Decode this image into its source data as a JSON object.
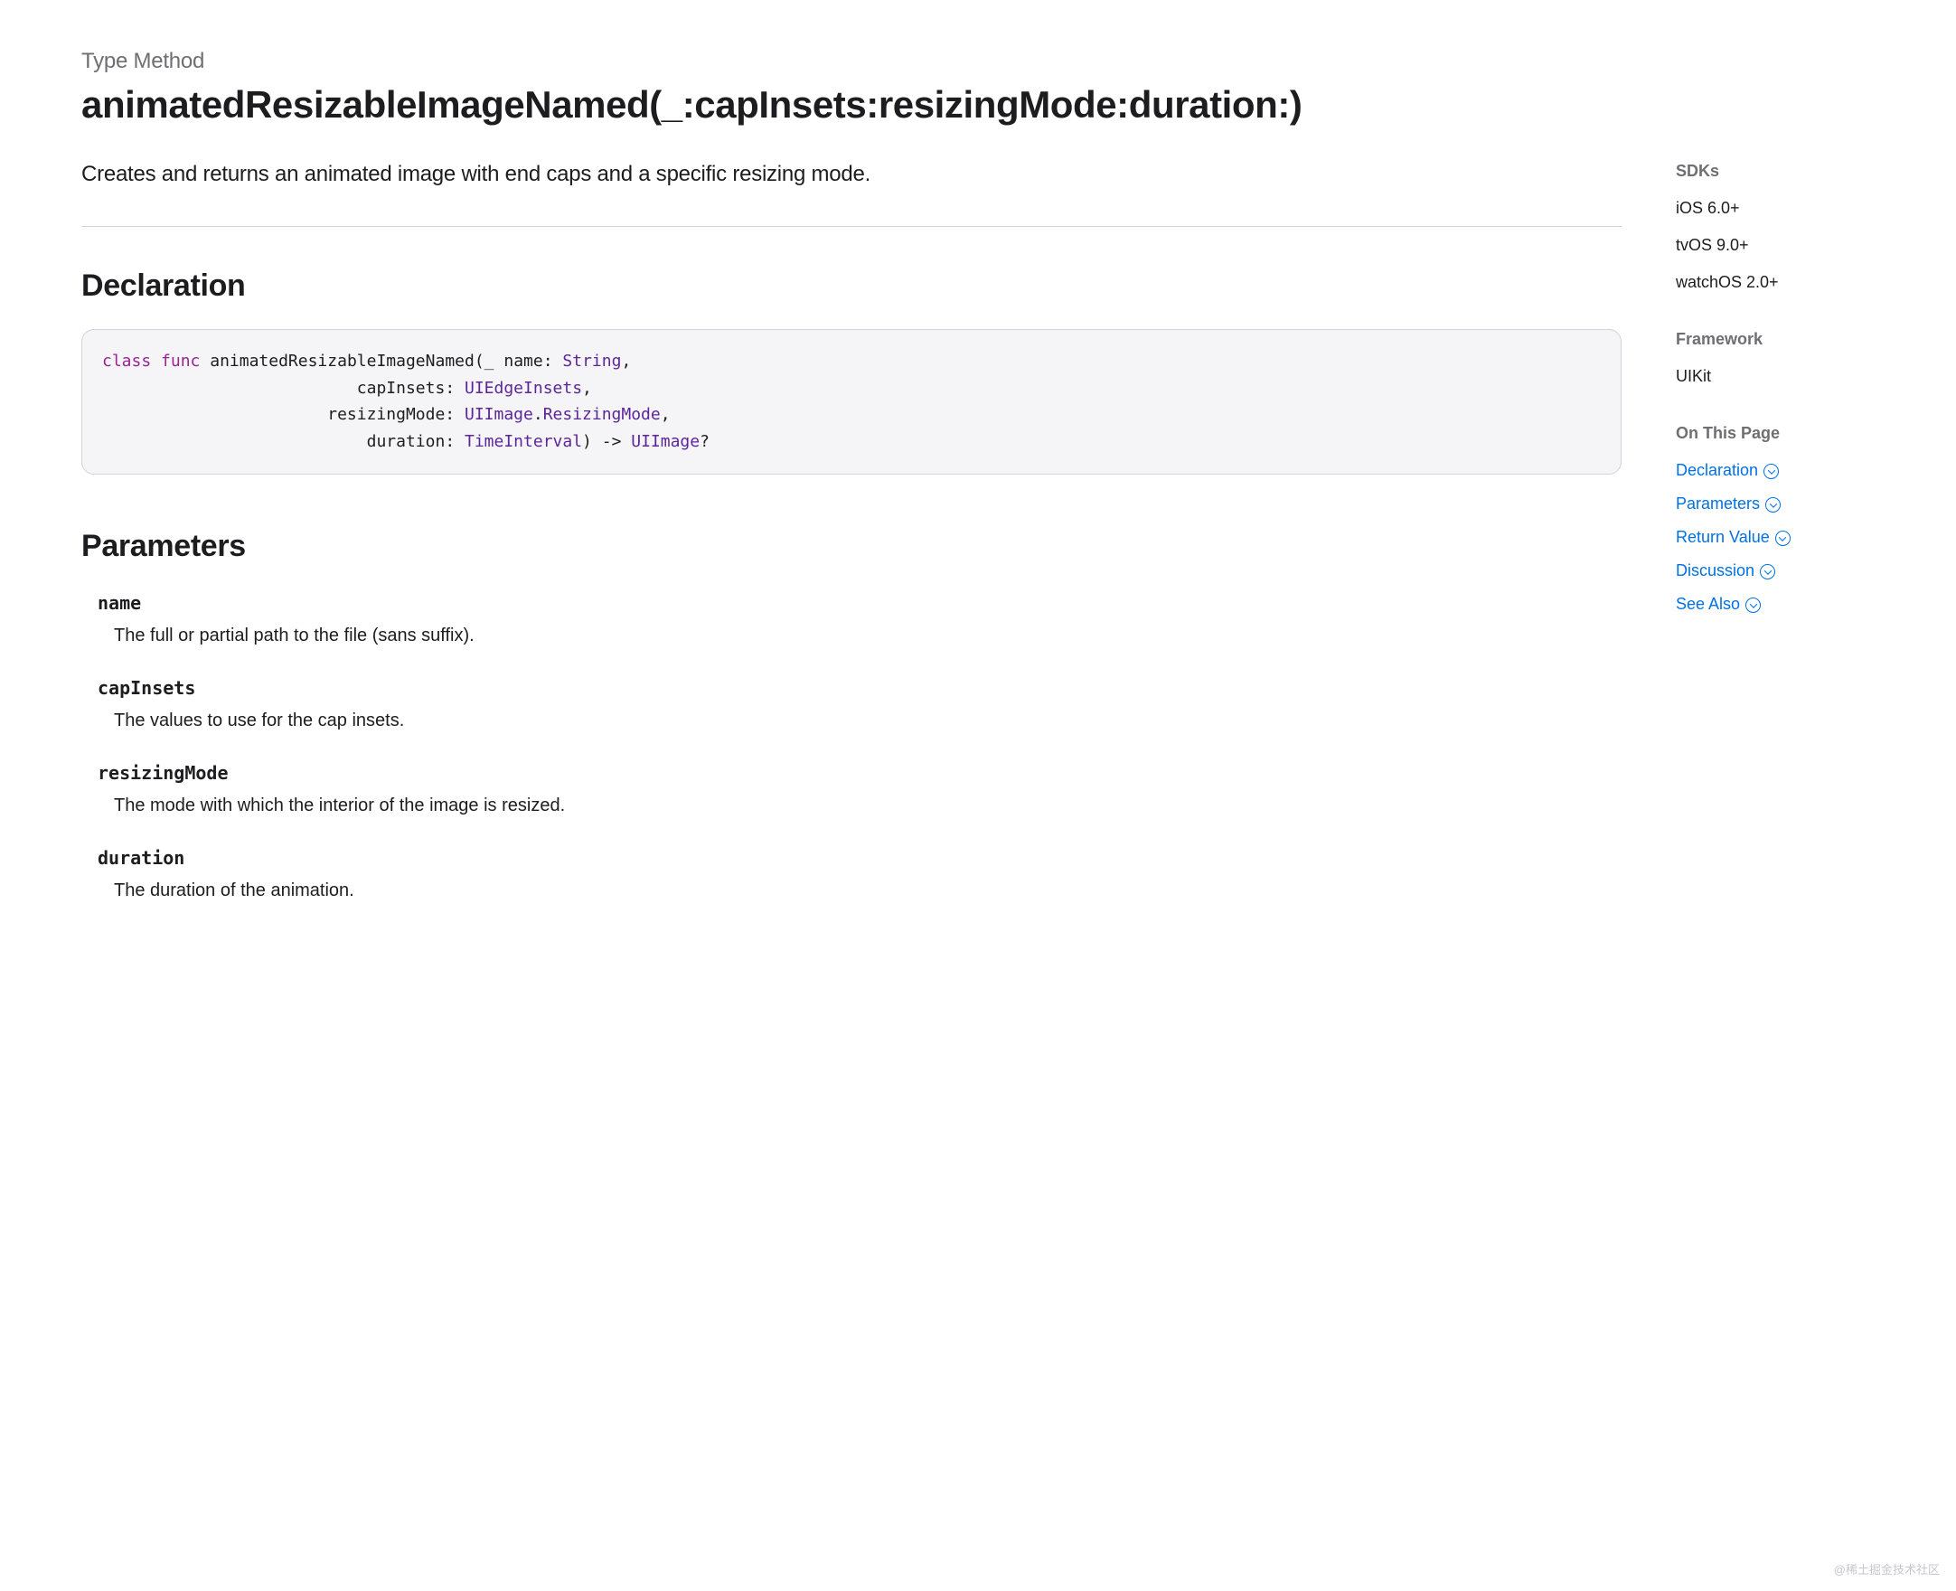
{
  "eyebrow": "Type Method",
  "title": "animatedResizableImageNamed(_:capInsets:resizingMode:duration:)",
  "summary": "Creates and returns an animated image with end caps and a specific resizing mode.",
  "sections": {
    "declaration": "Declaration",
    "parameters": "Parameters"
  },
  "declaration": {
    "kw_class": "class",
    "kw_func": "func",
    "fn": " animatedResizableImageNamed",
    "open": "(",
    "p1_label": "_ ",
    "p1_name": "name",
    "colon": ": ",
    "t_String": "String",
    "comma": ",",
    "p2_name": "capInsets",
    "t_UIEdgeInsets": "UIEdgeInsets",
    "p3_name": "resizingMode",
    "t_UIImage": "UIImage",
    "dot": ".",
    "t_ResizingMode": "ResizingMode",
    "p4_name": "duration",
    "t_TimeInterval": "TimeInterval",
    "close": ")",
    "arrow": " -> ",
    "ret": "UIImage",
    "opt": "?",
    "indent2": "                          ",
    "indent3": "                       ",
    "indent4": "                           "
  },
  "parameters": [
    {
      "name": "name",
      "desc": "The full or partial path to the file (sans suffix)."
    },
    {
      "name": "capInsets",
      "desc": "The values to use for the cap insets."
    },
    {
      "name": "resizingMode",
      "desc": "The mode with which the interior of the image is resized."
    },
    {
      "name": "duration",
      "desc": "The duration of the animation."
    }
  ],
  "sidebar": {
    "sdks_heading": "SDKs",
    "sdks": [
      "iOS 6.0+",
      "tvOS 9.0+",
      "watchOS 2.0+"
    ],
    "framework_heading": "Framework",
    "framework": "UIKit",
    "onthispage_heading": "On This Page",
    "jump": [
      "Declaration",
      "Parameters",
      "Return Value",
      "Discussion",
      "See Also"
    ]
  },
  "watermark": "@稀土掘金技术社区"
}
